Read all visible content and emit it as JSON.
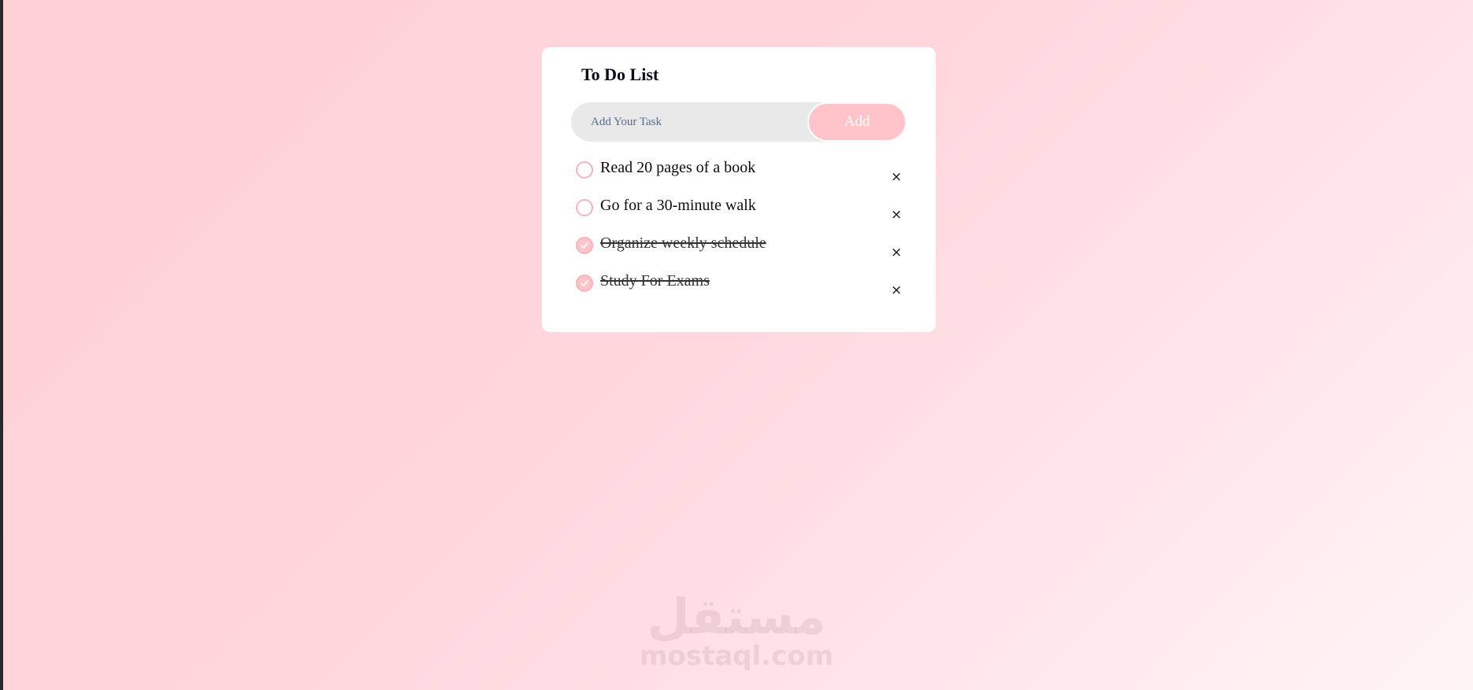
{
  "app": {
    "title": "To Do List"
  },
  "input": {
    "placeholder": "Add Your Task",
    "value": "",
    "add_label": "Add"
  },
  "tasks": [
    {
      "text": "Read 20 pages of a book",
      "done": false
    },
    {
      "text": "Go for a 30-minute walk",
      "done": false
    },
    {
      "text": "Organize weekly schedule",
      "done": true
    },
    {
      "text": "Study For Exams",
      "done": true
    }
  ],
  "remove_glyph": "×",
  "watermark": {
    "arabic": "مستقل",
    "latin": "mostaql.com"
  },
  "colors": {
    "accent": "#ffc4c9",
    "check_border": "#f4b4bd",
    "card": "#ffffff",
    "input_bg": "#e9e9e9"
  },
  "icons": {
    "check": "check-circle-icon",
    "remove": "close-icon"
  }
}
